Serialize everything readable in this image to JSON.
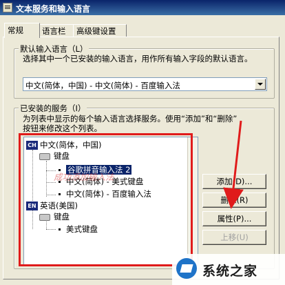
{
  "window": {
    "title": "文本服务和输入语言"
  },
  "tabs": [
    {
      "label": "常规"
    },
    {
      "label": "语言栏"
    },
    {
      "label": "高级键设置"
    }
  ],
  "default_language": {
    "legend": "默认输入语言（L）",
    "description": "选择其中一个已安装的输入语言，用作所有输入字段的默认语言。",
    "selected": "中文(简体，中国) - 中文(简体) - 百度输入法"
  },
  "installed_services": {
    "legend": "已安装的服务（I）",
    "description_line1": "为列表中显示的每个输入语言选择服务。使用“添加”和“删除”",
    "description_line2": "按钮来修改这个列表。",
    "tree": {
      "lang1_badge": "CH",
      "lang1": "中文(简体，中国)",
      "lang1_group": "键盘",
      "item1": "谷歌拼音输入法 2",
      "item2": "中文(简体) - 美式键盘",
      "item3": "中文(简体) - 百度输入法",
      "lang2_badge": "EN",
      "lang2": "英语(美国)",
      "lang2_group": "键盘",
      "item4": "美式键盘"
    },
    "buttons": {
      "add": "添加(D)...",
      "remove": "删除(R)",
      "properties": "属性(P)...",
      "move_up": "上移(U)"
    }
  },
  "overlay": {
    "watermark": "成功添加输入法",
    "logo_text": "系统之家",
    "accent": "#e01b1b"
  }
}
